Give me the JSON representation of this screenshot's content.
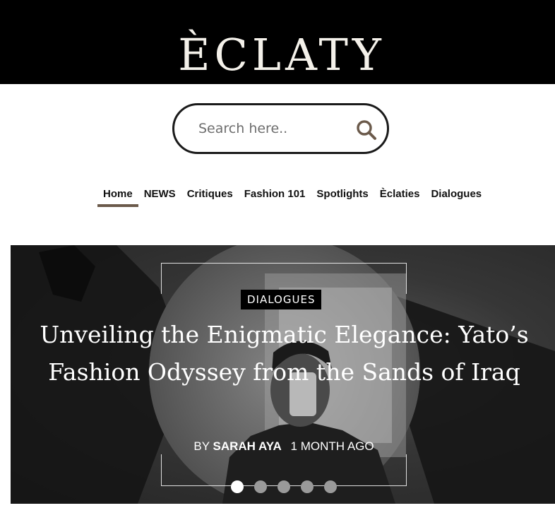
{
  "header": {
    "logo_text": "ÈCLATY",
    "background": "#000000"
  },
  "search": {
    "placeholder": "Search here..",
    "icon": "search-icon",
    "icon_color": "#6b5a4b"
  },
  "nav": {
    "items": [
      {
        "label": "Home",
        "active": true
      },
      {
        "label": "NEWS"
      },
      {
        "label": "Critiques"
      },
      {
        "label": "Fashion 101"
      },
      {
        "label": "Spotlights"
      },
      {
        "label": "Èclaties"
      },
      {
        "label": "Dialogues"
      }
    ],
    "active_color": "#6b5a4b"
  },
  "hero": {
    "category": "DIALOGUES",
    "headline": "Unveiling the Enigmatic Elegance: Yato’s Fashion Odyssey from the Sands of Iraq",
    "by_label": "BY",
    "author": "SARAH AYA",
    "time": "1 MONTH AGO",
    "slides": 5,
    "active_slide": 1
  }
}
